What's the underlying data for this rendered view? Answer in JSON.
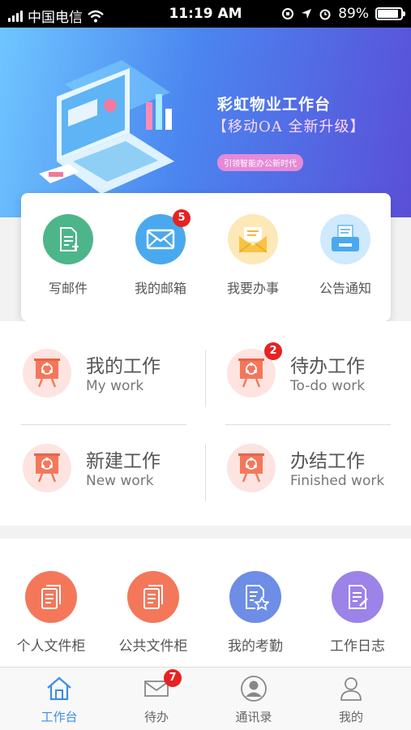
{
  "status_bar": {
    "carrier": "中国电信",
    "time": "11:19 AM",
    "battery": "89%",
    "battery_level": 0.89
  },
  "banner": {
    "title": "彩虹物业工作台",
    "subtitle": "【移动OA 全新升级】",
    "tag": "引领智能办公新时代"
  },
  "quick_actions": [
    {
      "label": "写邮件",
      "icon": "compose-mail-icon",
      "color": "#4db58a"
    },
    {
      "label": "我的邮箱",
      "icon": "mailbox-icon",
      "color": "#4aa9ee",
      "badge": "5"
    },
    {
      "label": "我要办事",
      "icon": "open-envelope-icon",
      "color": "#f7c342"
    },
    {
      "label": "公告通知",
      "icon": "notice-printer-icon",
      "color": "#4aa9ee"
    }
  ],
  "work_items": [
    {
      "cn": "我的工作",
      "en": "My work"
    },
    {
      "cn": "待办工作",
      "en": "To-do work",
      "badge": "2"
    },
    {
      "cn": "新建工作",
      "en": "New work"
    },
    {
      "cn": "办结工作",
      "en": "Finished work"
    }
  ],
  "tools": [
    {
      "label": "个人文件柜",
      "icon": "document-icon",
      "color": "#f4775a"
    },
    {
      "label": "公共文件柜",
      "icon": "document-icon",
      "color": "#f4775a"
    },
    {
      "label": "我的考勤",
      "icon": "attendance-icon",
      "color": "#6d8de6"
    },
    {
      "label": "工作日志",
      "icon": "worklog-icon",
      "color": "#9b83e8"
    }
  ],
  "tabbar": {
    "items": [
      {
        "label": "工作台",
        "icon": "home-icon",
        "active": true
      },
      {
        "label": "待办",
        "icon": "mail-icon",
        "badge": "7"
      },
      {
        "label": "通讯录",
        "icon": "contacts-icon"
      },
      {
        "label": "我的",
        "icon": "profile-icon"
      }
    ],
    "active_color": "#3b8ee8"
  }
}
